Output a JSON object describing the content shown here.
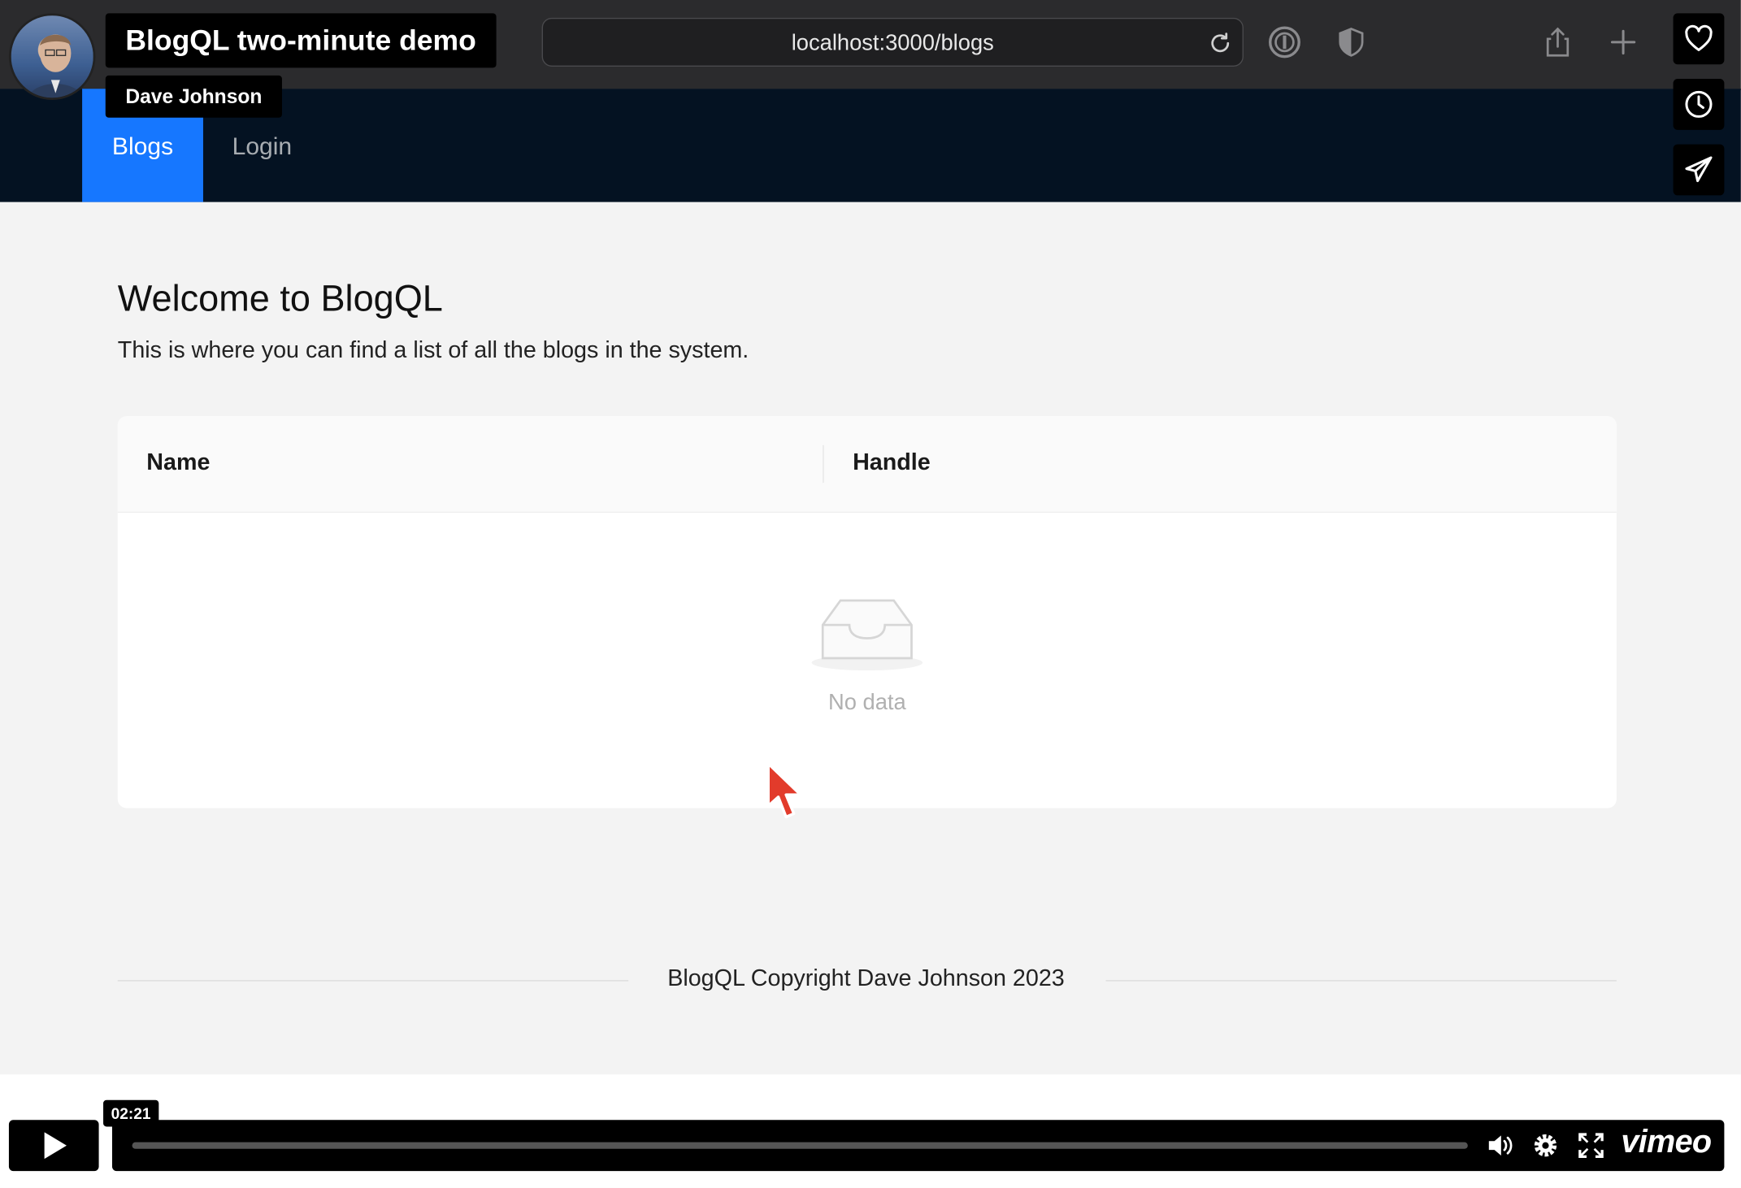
{
  "browser": {
    "url": "localhost:3000/blogs"
  },
  "video": {
    "title": "BlogQL two-minute demo",
    "author": "Dave Johnson",
    "timestamp": "02:21",
    "brand": "vimeo"
  },
  "nav": {
    "tabs": [
      {
        "label": "Blogs",
        "active": true
      },
      {
        "label": "Login",
        "active": false
      }
    ]
  },
  "main": {
    "title": "Welcome to BlogQL",
    "subtitle": "This is where you can find a list of all the blogs in the system.",
    "table": {
      "columns": [
        "Name",
        "Handle"
      ],
      "rows": [],
      "empty_text": "No data"
    }
  },
  "footer": {
    "text": "BlogQL Copyright Dave Johnson 2023"
  },
  "colors": {
    "nav_background": "#041222",
    "active_tab": "#1677ff",
    "page_background": "#f3f3f3"
  }
}
